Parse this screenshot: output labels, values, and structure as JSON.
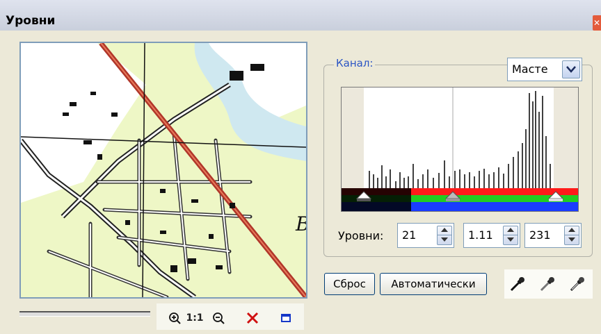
{
  "window": {
    "title": "Уровни",
    "close_glyph": "✕"
  },
  "channel": {
    "label": "Канал:",
    "selected": "Масте"
  },
  "levels": {
    "label": "Уровни:",
    "black": "21",
    "gamma": "1.11",
    "white": "231"
  },
  "buttons": {
    "reset": "Сброс",
    "auto": "Автоматически"
  },
  "zoom": {
    "zoom_in_icon": "zoom-in-icon",
    "one_to_one": "1:1",
    "zoom_out_icon": "zoom-out-icon",
    "close_icon": "red-x-icon",
    "fit_icon": "frame-icon"
  },
  "pipettes": [
    "black-eyedropper-icon",
    "gray-eyedropper-icon",
    "white-eyedropper-icon"
  ],
  "colors": {
    "accent": "#2b55c4",
    "red_bar": "#ff1a1a",
    "green_bar": "#22cc22",
    "blue_bar": "#1a3cff"
  }
}
